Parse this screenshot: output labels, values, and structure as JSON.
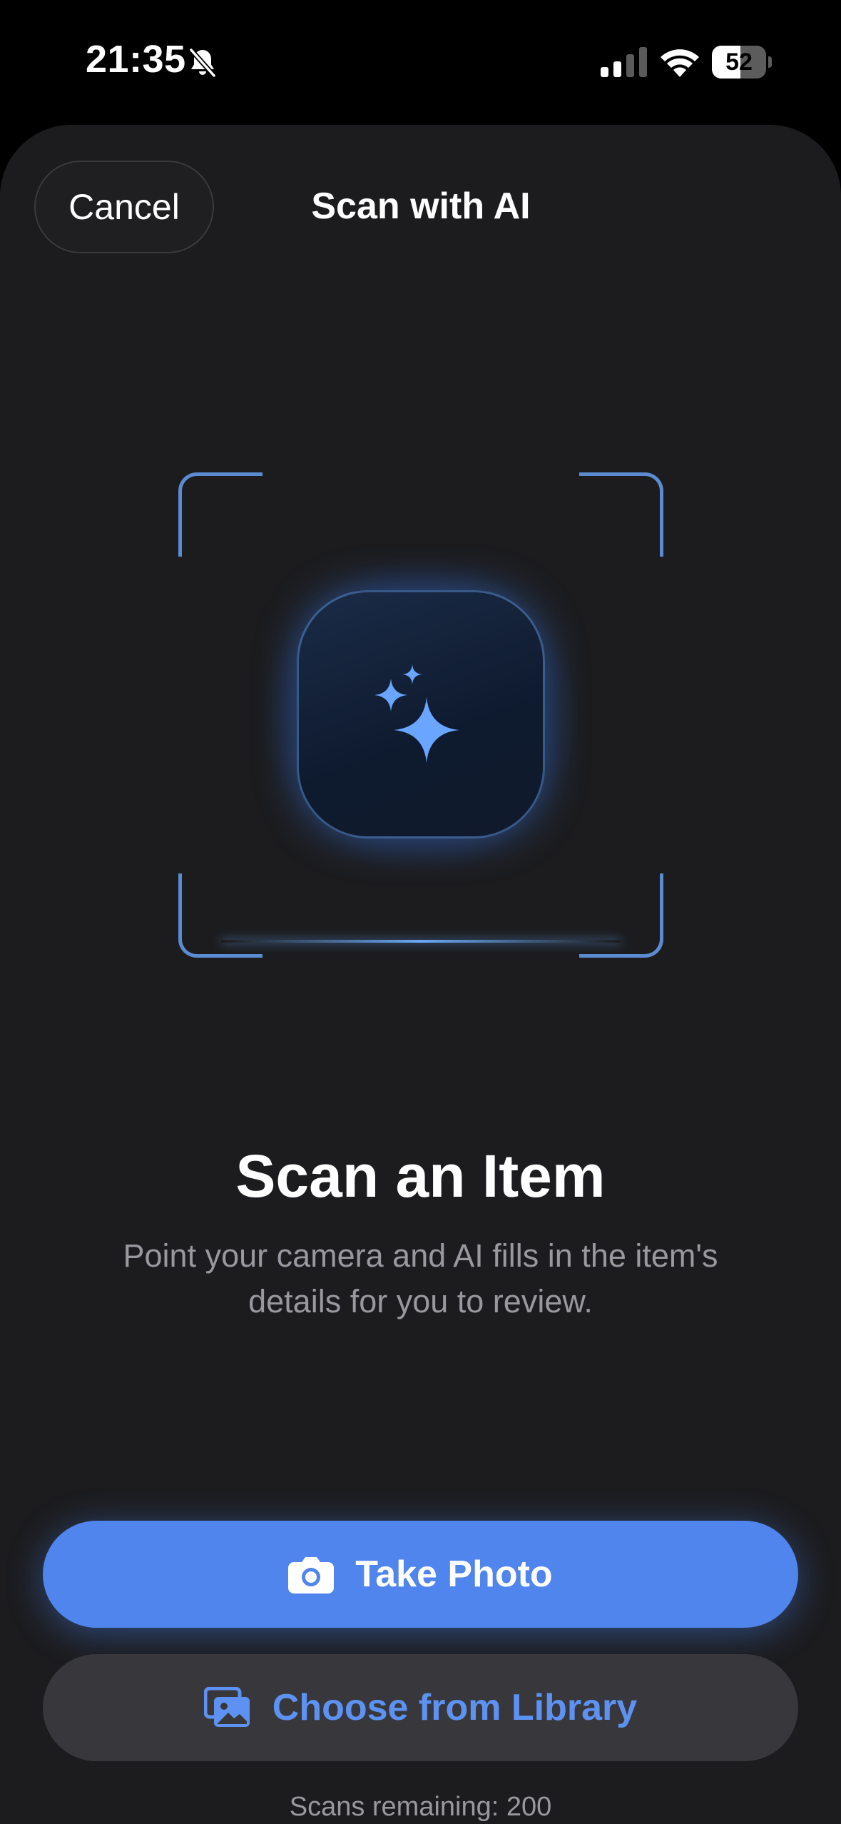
{
  "status_bar": {
    "time": "21:35",
    "battery_level": "52",
    "battery_fraction": 0.52,
    "icons": [
      "bell-slash-icon",
      "cellular-signal-icon",
      "wifi-icon",
      "battery-icon"
    ]
  },
  "header": {
    "cancel_label": "Cancel",
    "title": "Scan with AI"
  },
  "hero": {
    "icon": "sparkles-icon",
    "heading": "Scan an Item",
    "description": "Point your camera and AI fills in the item's details for you to review."
  },
  "actions": {
    "take_photo_label": "Take Photo",
    "take_photo_icon": "camera-icon",
    "library_label": "Choose from Library",
    "library_icon": "photos-icon"
  },
  "footer": {
    "scans_remaining": "Scans remaining: 200"
  },
  "colors": {
    "background": "#000000",
    "sheet": "#1c1c1e",
    "accent": "#4f85ec",
    "accent_text": "#5d92f2",
    "secondary_button": "#38383c",
    "secondary_text": "#98989e",
    "frame_corners": "#5b8bd0"
  }
}
